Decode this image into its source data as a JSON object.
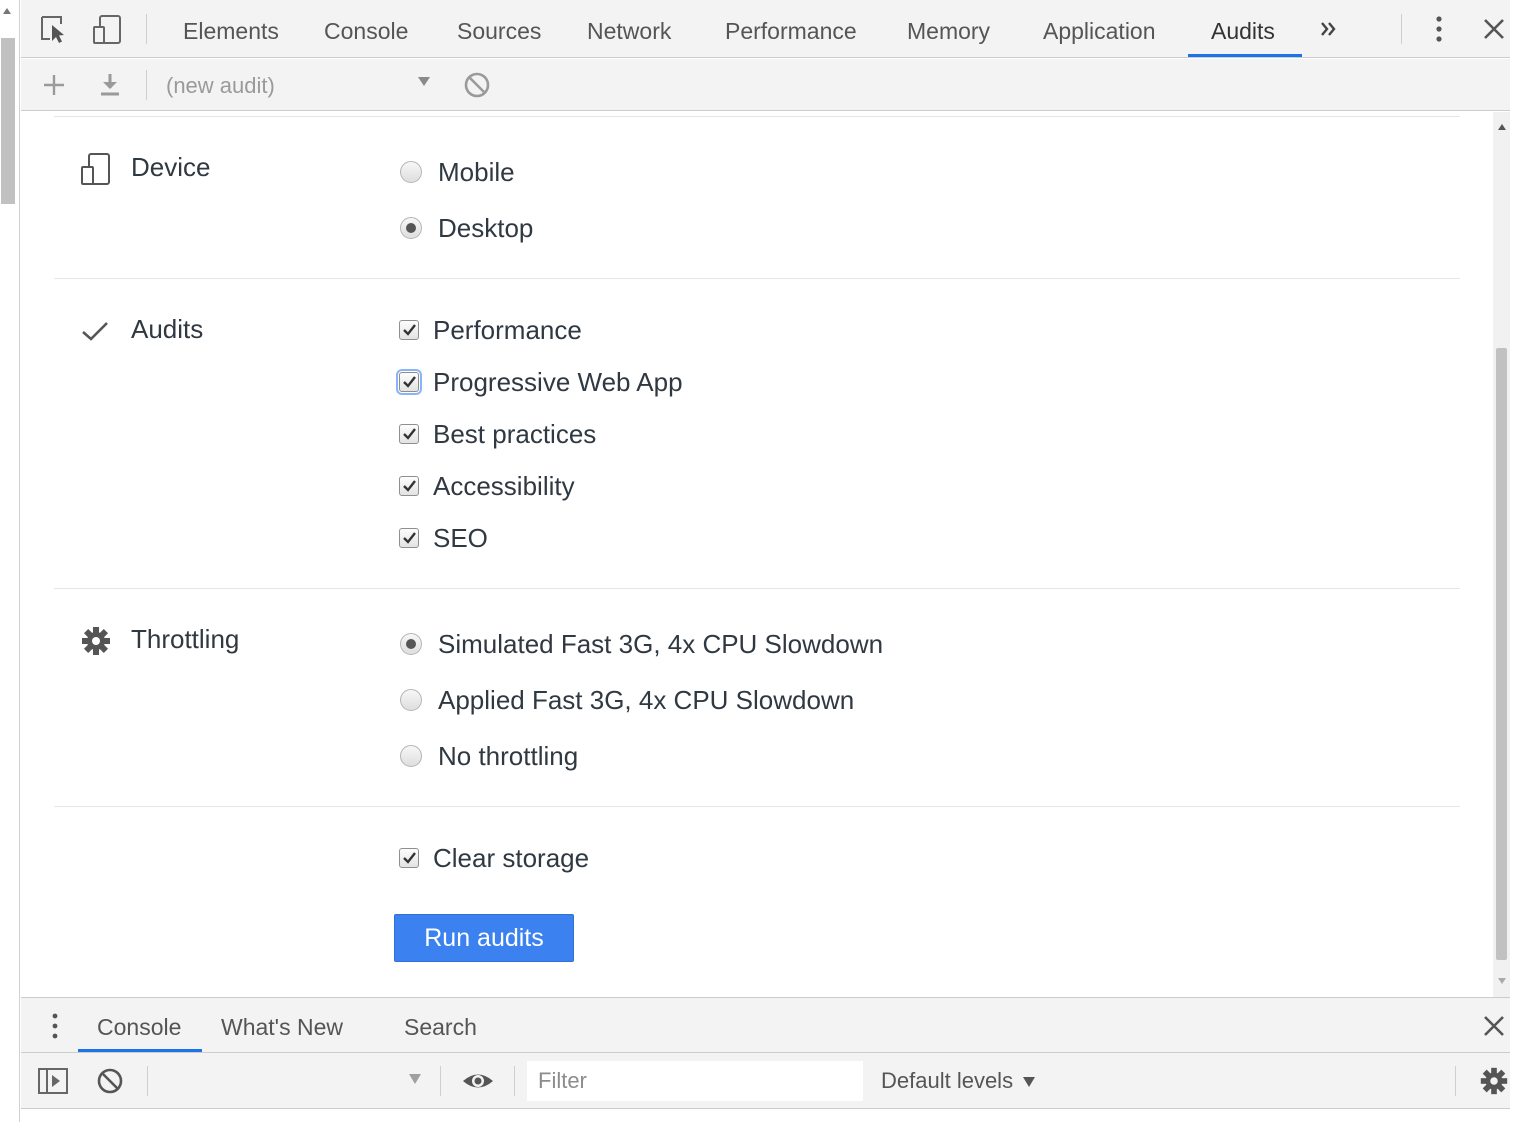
{
  "main_tabs": [
    {
      "label": "Elements"
    },
    {
      "label": "Console"
    },
    {
      "label": "Sources"
    },
    {
      "label": "Network"
    },
    {
      "label": "Performance"
    },
    {
      "label": "Memory"
    },
    {
      "label": "Application"
    },
    {
      "label": "Audits",
      "active": true
    }
  ],
  "audit_toolbar": {
    "audit_select_value": "(new audit)"
  },
  "device": {
    "label": "Device",
    "options": [
      {
        "label": "Mobile",
        "selected": false
      },
      {
        "label": "Desktop",
        "selected": true
      }
    ]
  },
  "audits": {
    "label": "Audits",
    "options": [
      {
        "label": "Performance",
        "checked": true
      },
      {
        "label": "Progressive Web App",
        "checked": true,
        "focused": true
      },
      {
        "label": "Best practices",
        "checked": true
      },
      {
        "label": "Accessibility",
        "checked": true
      },
      {
        "label": "SEO",
        "checked": true
      }
    ]
  },
  "throttling": {
    "label": "Throttling",
    "options": [
      {
        "label": "Simulated Fast 3G, 4x CPU Slowdown",
        "selected": true
      },
      {
        "label": "Applied Fast 3G, 4x CPU Slowdown",
        "selected": false
      },
      {
        "label": "No throttling",
        "selected": false
      }
    ]
  },
  "clear_storage": {
    "label": "Clear storage",
    "checked": true
  },
  "run_button": {
    "label": "Run audits"
  },
  "drawer": {
    "tabs": [
      {
        "label": "Console",
        "active": true
      },
      {
        "label": "What's New"
      },
      {
        "label": "Search"
      }
    ],
    "filter_placeholder": "Filter",
    "levels_label": "Default levels"
  },
  "colors": {
    "accent": "#1a73e8",
    "run_button_bg": "#3b82f0"
  }
}
